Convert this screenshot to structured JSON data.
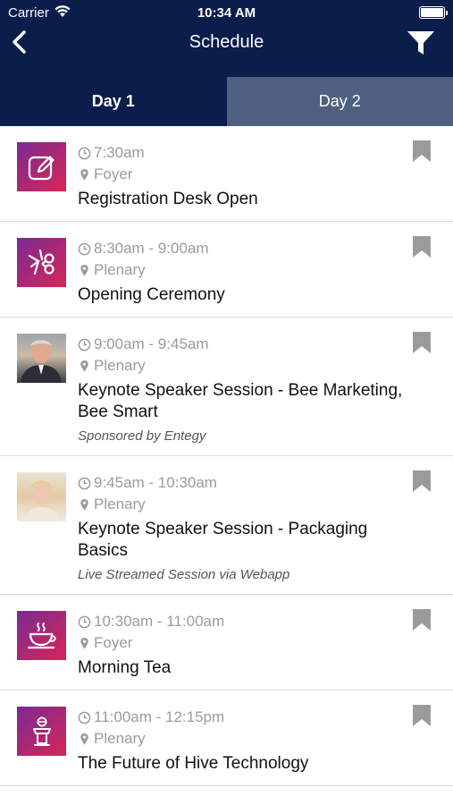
{
  "status_bar": {
    "carrier": "Carrier",
    "time": "10:34 AM"
  },
  "header": {
    "title": "Schedule",
    "back_icon": "chevron-left-icon",
    "filter_icon": "filter-funnel-icon"
  },
  "tabs": [
    {
      "label": "Day 1",
      "active": true
    },
    {
      "label": "Day 2",
      "active": false
    }
  ],
  "sessions": [
    {
      "time": "7:30am",
      "location": "Foyer",
      "title": "Registration Desk Open",
      "note": "",
      "thumb": "pencil-edit-icon"
    },
    {
      "time": "8:30am - 9:00am",
      "location": "Plenary",
      "title": "Opening Ceremony",
      "note": "",
      "thumb": "ribbon-cut-icon"
    },
    {
      "time": "9:00am - 9:45am",
      "location": "Plenary",
      "title": "Keynote Speaker Session - Bee Marketing, Bee Smart",
      "note": "Sponsored by Entegy",
      "thumb": "speaker-photo-man"
    },
    {
      "time": "9:45am - 10:30am",
      "location": "Plenary",
      "title": "Keynote Speaker Session - Packaging Basics",
      "note": "Live Streamed Session via Webapp",
      "thumb": "speaker-photo-woman"
    },
    {
      "time": "10:30am - 11:00am",
      "location": "Foyer",
      "title": "Morning Tea",
      "note": "",
      "thumb": "coffee-cup-icon"
    },
    {
      "time": "11:00am - 12:15pm",
      "location": "Plenary",
      "title": "The Future of Hive Technology",
      "note": "",
      "thumb": "lectern-speaker-icon"
    }
  ],
  "colors": {
    "header_bg": "#0b1d4a",
    "tab_inactive_bg": "#4f5f7f",
    "accent_gradient_start": "#7a2a93",
    "accent_gradient_end": "#d9245a",
    "muted_text": "#9b9b9b"
  }
}
